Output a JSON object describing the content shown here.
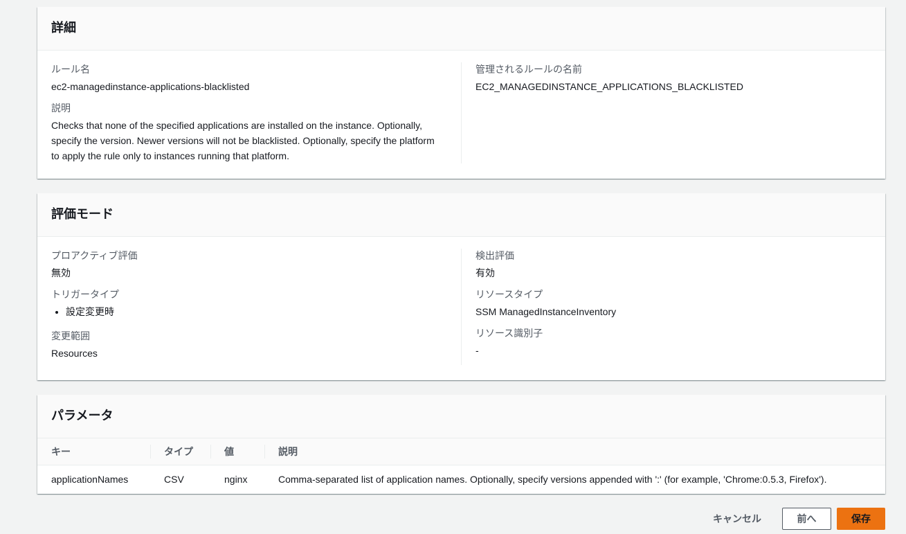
{
  "details": {
    "title": "詳細",
    "rule_name_label": "ルール名",
    "rule_name_value": "ec2-managedinstance-applications-blacklisted",
    "description_label": "説明",
    "description_value": "Checks that none of the specified applications are installed on the instance. Optionally, specify the version. Newer versions will not be blacklisted. Optionally, specify the platform to apply the rule only to instances running that platform.",
    "managed_rule_label": "管理されるルールの名前",
    "managed_rule_value": "EC2_MANAGEDINSTANCE_APPLICATIONS_BLACKLISTED"
  },
  "evaluation": {
    "title": "評価モード",
    "proactive_label": "プロアクティブ評価",
    "proactive_value": "無効",
    "trigger_type_label": "トリガータイプ",
    "trigger_types": [
      "設定変更時"
    ],
    "scope_label": "変更範囲",
    "scope_value": "Resources",
    "detective_label": "検出評価",
    "detective_value": "有効",
    "resource_type_label": "リソースタイプ",
    "resource_type_value": "SSM ManagedInstanceInventory",
    "resource_id_label": "リソース識別子",
    "resource_id_value": "-"
  },
  "parameters": {
    "title": "パラメータ",
    "columns": [
      "キー",
      "タイプ",
      "値",
      "説明"
    ],
    "rows": [
      {
        "key": "applicationNames",
        "type": "CSV",
        "value": "nginx",
        "description": "Comma-separated list of application names. Optionally, specify versions appended with ':' (for example, 'Chrome:0.5.3, Firefox')."
      }
    ]
  },
  "footer": {
    "cancel_label": "キャンセル",
    "previous_label": "前へ",
    "save_label": "保存"
  },
  "colors": {
    "primary_button": "#ec7211",
    "background": "#f2f3f3"
  }
}
